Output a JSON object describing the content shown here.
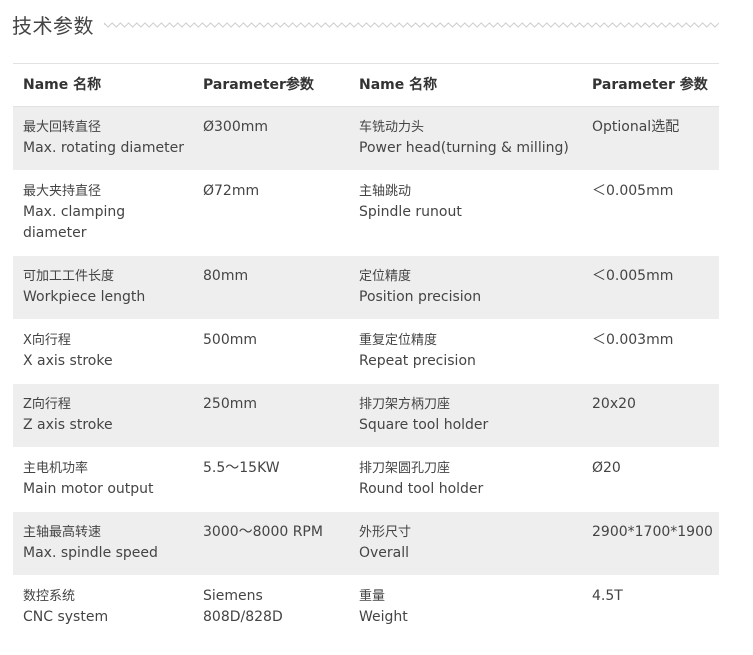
{
  "section": {
    "title": "技术参数"
  },
  "table": {
    "headers": [
      "Name 名称",
      "Parameter参数",
      "Name 名称",
      "Parameter 参数"
    ],
    "rows": [
      {
        "name1_cn": "最大回转直径",
        "name1_en": "Max. rotating diameter",
        "value1": "Ø300mm",
        "name2_cn": "车铣动力头",
        "name2_en": "Power head(turning & milling)",
        "value2": "Optional选配"
      },
      {
        "name1_cn": "最大夹持直径",
        "name1_en": "Max. clamping diameter",
        "value1": "Ø72mm",
        "name2_cn": "主轴跳动",
        "name2_en": "Spindle runout",
        "value2": "＜0.005mm"
      },
      {
        "name1_cn": "可加工工件长度",
        "name1_en": "Workpiece length",
        "value1": "80mm",
        "name2_cn": "定位精度",
        "name2_en": "Position precision",
        "value2": "＜0.005mm"
      },
      {
        "name1_cn": "X向行程",
        "name1_en": "X axis stroke",
        "value1": "500mm",
        "name2_cn": "重复定位精度",
        "name2_en": "Repeat precision",
        "value2": "＜0.003mm"
      },
      {
        "name1_cn": "Z向行程",
        "name1_en": "Z axis stroke",
        "value1": "250mm",
        "name2_cn": "排刀架方柄刀座",
        "name2_en": "Square tool holder",
        "value2": "20x20"
      },
      {
        "name1_cn": "主电机功率",
        "name1_en": "Main motor output",
        "value1": "5.5～15KW",
        "name2_cn": "排刀架圆孔刀座",
        "name2_en": "Round tool holder",
        "value2": "Ø20"
      },
      {
        "name1_cn": "主轴最高转速",
        "name1_en": "Max. spindle speed",
        "value1": "3000～8000 RPM",
        "name2_cn": "外形尺寸",
        "name2_en": "Overall",
        "value2": "2900*1700*1900"
      },
      {
        "name1_cn": "数控系统",
        "name1_en": "CNC system",
        "value1": "Siemens 808D/828D",
        "name2_cn": "重量",
        "name2_en": "Weight",
        "value2": "4.5T"
      }
    ]
  }
}
